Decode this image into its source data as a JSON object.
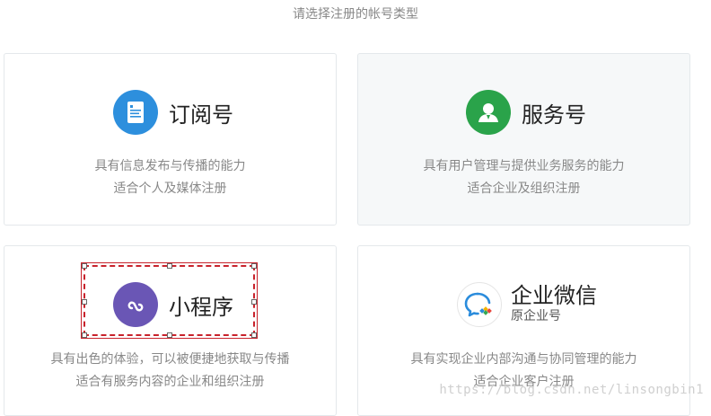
{
  "header": {
    "title": "请选择注册的帐号类型"
  },
  "cards": [
    {
      "name": "订阅号",
      "desc_line1": "具有信息发布与传播的能力",
      "desc_line2": "适合个人及媒体注册",
      "icon": "document-icon",
      "icon_color": "#2d8fdd"
    },
    {
      "name": "服务号",
      "desc_line1": "具有用户管理与提供业务服务的能力",
      "desc_line2": "适合企业及组织注册",
      "icon": "user-icon",
      "icon_color": "#2aa34a"
    },
    {
      "name": "小程序",
      "desc_line1": "具有出色的体验，可以被便捷地获取与传播",
      "desc_line2": "适合有服务内容的企业和组织注册",
      "icon": "link-icon",
      "icon_color": "#6a56b5"
    },
    {
      "name": "企业微信",
      "subname": "原企业号",
      "desc_line1": "具有实现企业内部沟通与协同管理的能力",
      "desc_line2": "适合企业客户注册",
      "icon": "chat-bubble-icon",
      "icon_color": "#2b8cdc"
    }
  ],
  "watermark": "https://blog.csdn.net/linsongbin1",
  "colors": {
    "selection": "#c8232c",
    "hover_bg": "#f6f8f9",
    "border": "#e4e8eb"
  }
}
